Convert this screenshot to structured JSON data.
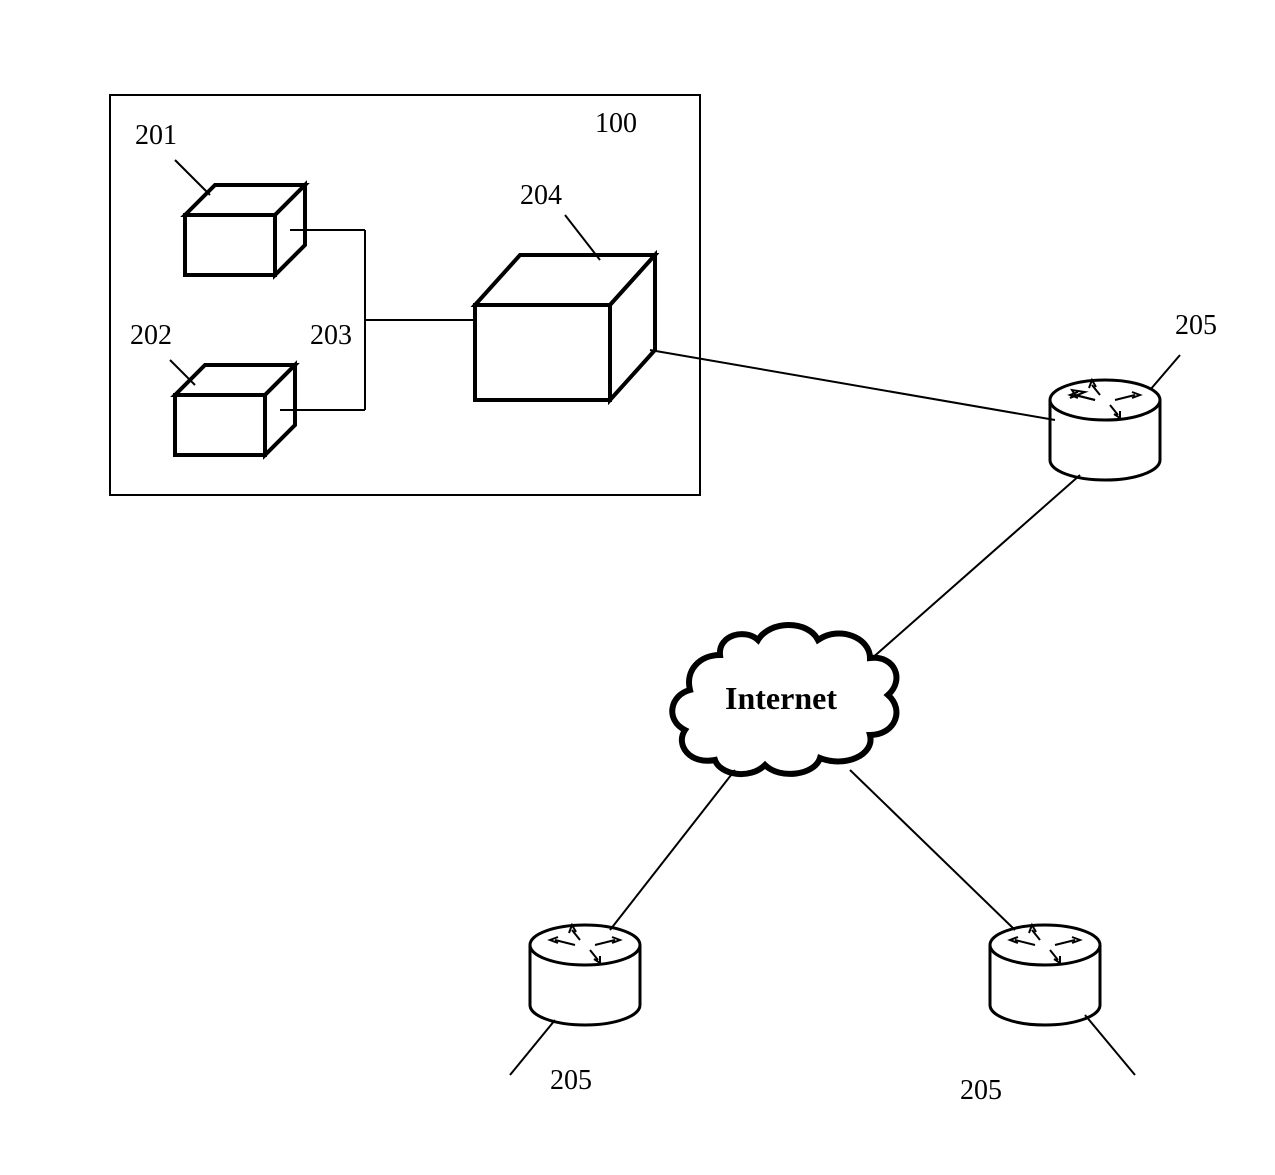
{
  "labels": {
    "box_100": "100",
    "node_201": "201",
    "node_202": "202",
    "junction_203": "203",
    "node_204": "204",
    "router_top": "205",
    "router_bottom_left": "205",
    "router_bottom_right": "205",
    "cloud": "Internet"
  },
  "diagram": {
    "type": "network-topology",
    "description": "Network diagram showing a boxed system (100) containing three 3D box nodes (201, 202, 204) connected via junction 203. Node 204 connects to a router (205), which connects to an Internet cloud. Two more routers (205) connect below the cloud."
  }
}
